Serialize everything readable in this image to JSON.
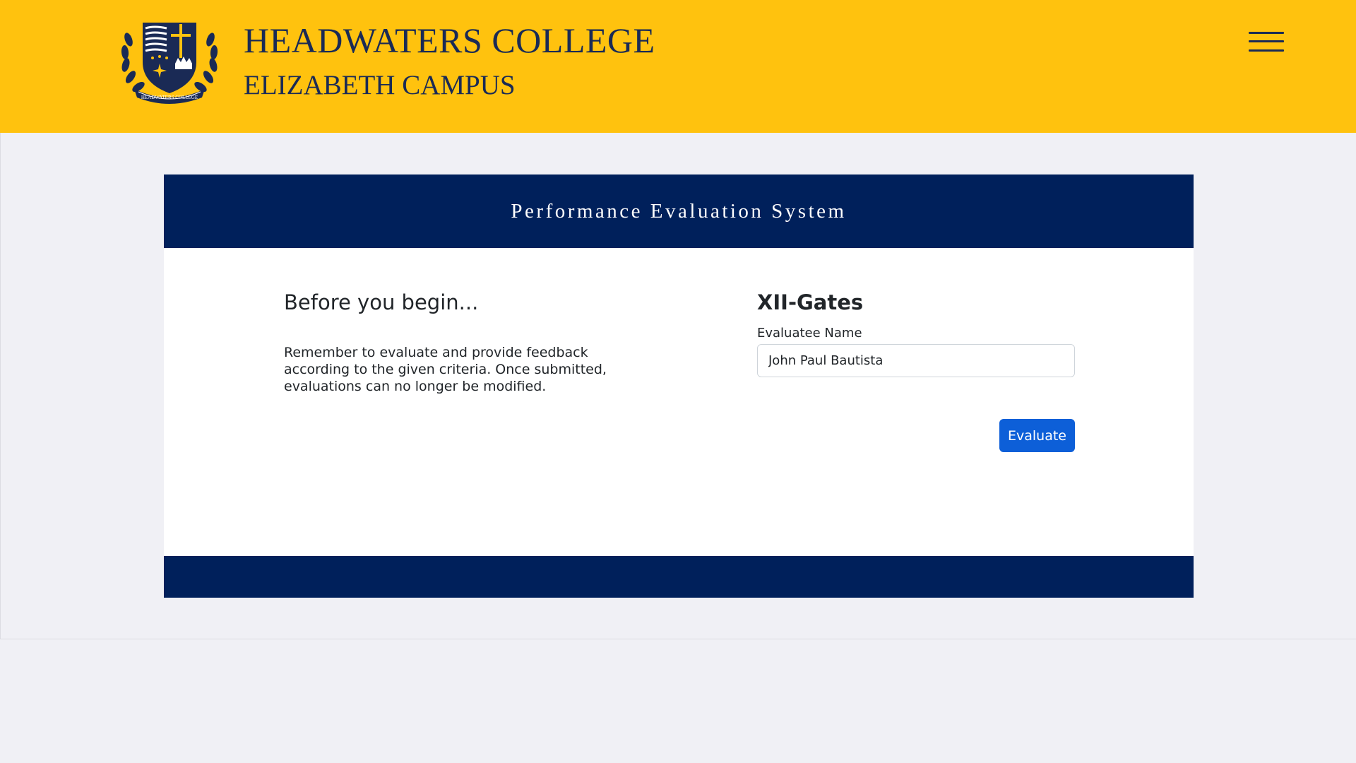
{
  "header": {
    "title": "HEADWATERS COLLEGE",
    "subtitle": "ELIZABETH CAMPUS",
    "logo_text": "HEADWATERS COLLEGE",
    "menu_icon": "hamburger-menu-icon"
  },
  "card": {
    "title": "Performance Evaluation System"
  },
  "intro": {
    "heading": "Before you begin...",
    "text": "Remember to evaluate and provide feedback according to the given criteria. Once submitted, evaluations can no longer be modified."
  },
  "form": {
    "group_title": "XII-Gates",
    "evaluatee_label": "Evaluatee Name",
    "evaluatee_value": "John Paul Bautista",
    "submit_label": "Evaluate"
  },
  "colors": {
    "header_bg": "#ffc20e",
    "navy": "#00205b",
    "button_blue": "#0d5fd8",
    "page_bg": "#f0f0f5"
  }
}
